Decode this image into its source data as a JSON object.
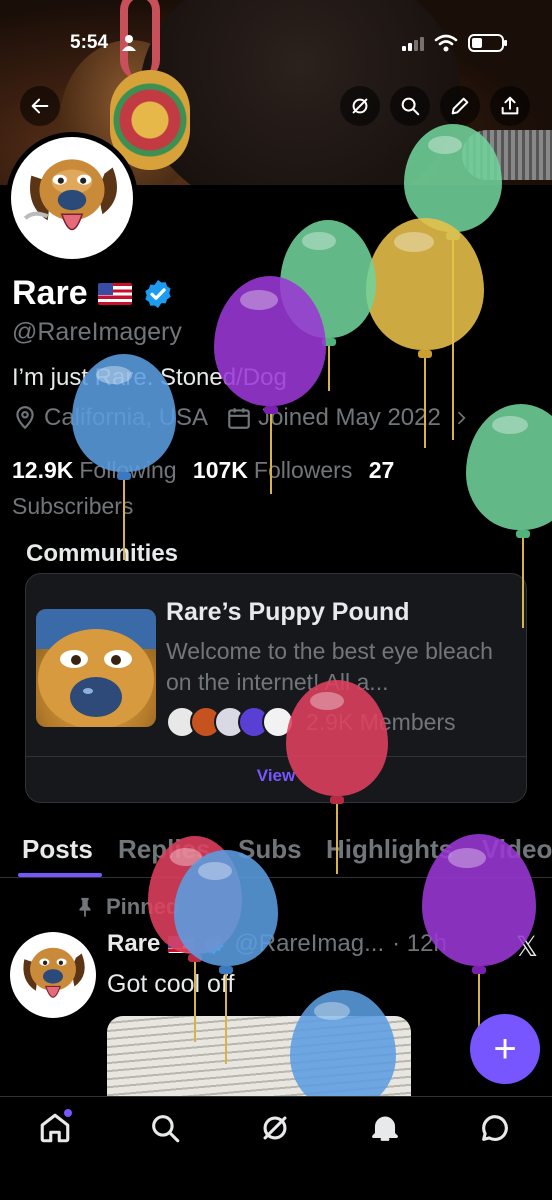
{
  "status_bar": {
    "time": "5:54"
  },
  "profile": {
    "name": "Rare",
    "handle": "@RareImagery",
    "bio": "I’m just Rare. Stoned/Dog",
    "location": "California, USA",
    "joined": "Joined May 2022",
    "following_count": "12.9K",
    "following_label": "Following",
    "followers_count": "107K",
    "followers_label": "Followers",
    "subscribers_count": "27",
    "subscribers_label": "Subscribers"
  },
  "communities": {
    "title": "Communities",
    "card": {
      "name": "Rare’s Puppy Pound",
      "description": "Welcome to the best eye bleach on the internet! All a...",
      "members": "2.9K Members",
      "view_label": "View"
    }
  },
  "tabs": [
    "Posts",
    "Replies",
    "Subs",
    "Highlights",
    "Videos"
  ],
  "pinned_post": {
    "pinned_label": "Pinned",
    "author": "Rare",
    "handle": "@RareImag...",
    "time": "· 12h",
    "text": "Got cool off"
  },
  "fab_label": "+",
  "bottom_nav": [
    "home-icon",
    "search-icon",
    "grok-icon",
    "notifications-icon",
    "messages-icon"
  ],
  "colors": {
    "accent": "#7856ff",
    "verified": "#1d9bf0",
    "background": "#000000",
    "secondary_text": "#71767b"
  }
}
